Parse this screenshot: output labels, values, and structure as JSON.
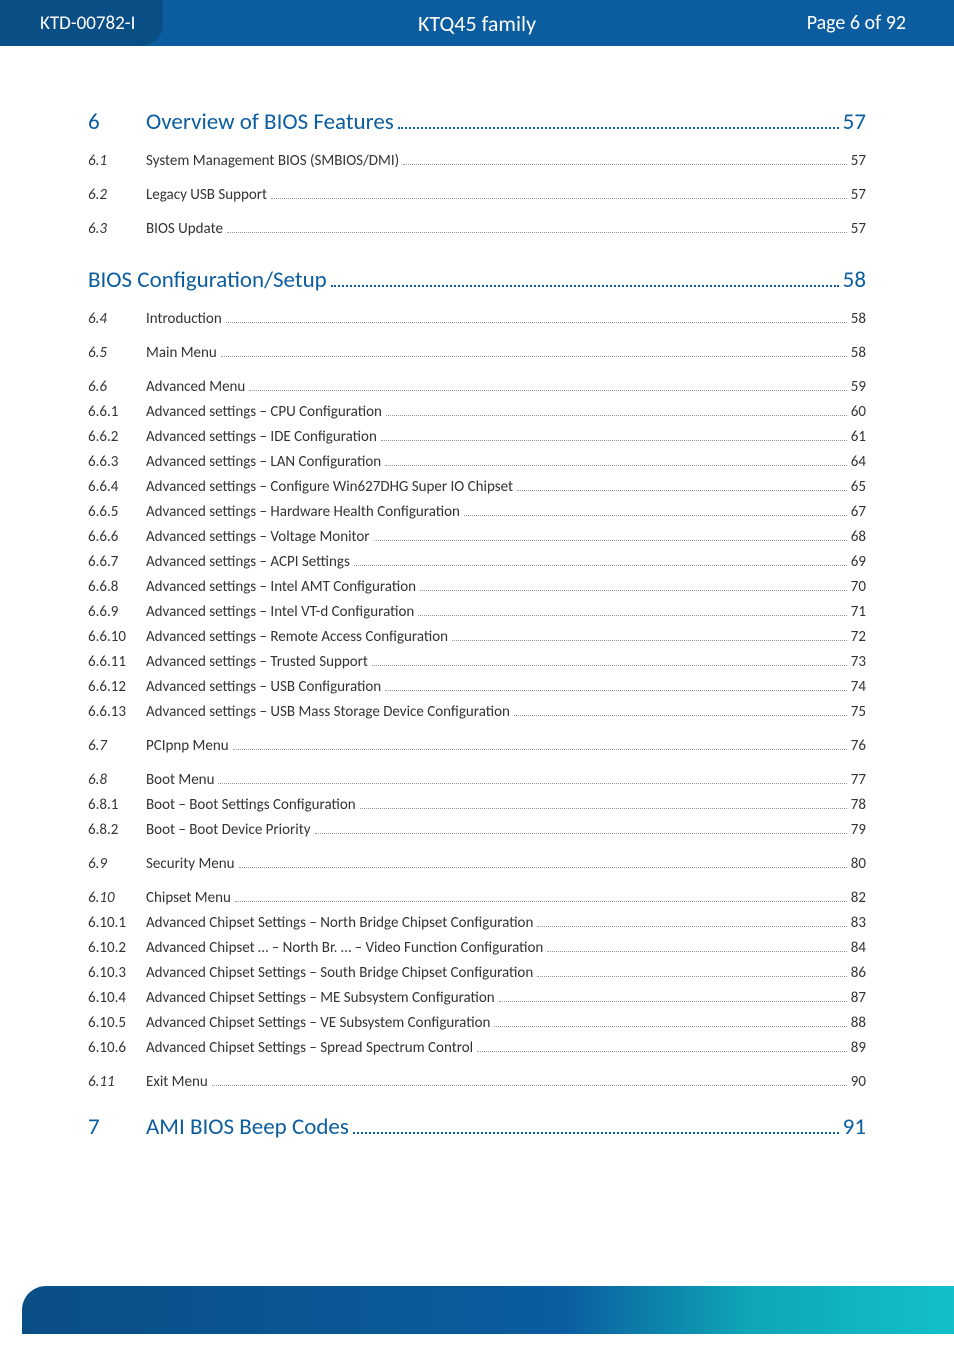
{
  "header": {
    "doc_id": "KTD-00782-I",
    "family": "KTQ45 family",
    "page_label": "Page 6 of 92"
  },
  "toc": [
    {
      "level": "chapter",
      "num": "6",
      "title": "Overview of BIOS Features",
      "page": "57"
    },
    {
      "level": "h2",
      "num": "6.1",
      "title": "System Management BIOS (SMBIOS/DMI)",
      "page": "57"
    },
    {
      "level": "h2",
      "num": "6.2",
      "title": "Legacy USB Support",
      "page": "57"
    },
    {
      "level": "h2",
      "num": "6.3",
      "title": "BIOS Update",
      "page": "57"
    },
    {
      "level": "section-heading",
      "num": "",
      "title": "BIOS Configuration/Setup",
      "page": "58"
    },
    {
      "level": "h2",
      "num": "6.4",
      "title": "Introduction",
      "page": "58"
    },
    {
      "level": "h2",
      "num": "6.5",
      "title": "Main Menu",
      "page": "58"
    },
    {
      "level": "h2",
      "num": "6.6",
      "title": "Advanced Menu",
      "page": "59"
    },
    {
      "level": "h3",
      "num": "6.6.1",
      "title": "Advanced settings – CPU Configuration",
      "page": "60"
    },
    {
      "level": "h3",
      "num": "6.6.2",
      "title": "Advanced settings – IDE Configuration",
      "page": "61"
    },
    {
      "level": "h3",
      "num": "6.6.3",
      "title": "Advanced settings – LAN Configuration",
      "page": "64"
    },
    {
      "level": "h3",
      "num": "6.6.4",
      "title": "Advanced settings – Configure Win627DHG Super IO Chipset",
      "page": "65"
    },
    {
      "level": "h3",
      "num": "6.6.5",
      "title": "Advanced settings – Hardware Health Configuration",
      "page": "67"
    },
    {
      "level": "h3",
      "num": "6.6.6",
      "title": "Advanced settings – Voltage Monitor",
      "page": "68"
    },
    {
      "level": "h3",
      "num": "6.6.7",
      "title": "Advanced settings – ACPI Settings",
      "page": "69"
    },
    {
      "level": "h3",
      "num": "6.6.8",
      "title": "Advanced settings – Intel AMT Configuration",
      "page": "70"
    },
    {
      "level": "h3",
      "num": "6.6.9",
      "title": "Advanced settings – Intel VT-d Configuration",
      "page": "71"
    },
    {
      "level": "h3",
      "num": "6.6.10",
      "title": "Advanced settings – Remote Access Configuration",
      "page": "72"
    },
    {
      "level": "h3",
      "num": "6.6.11",
      "title": "Advanced settings – Trusted Support",
      "page": "73"
    },
    {
      "level": "h3",
      "num": "6.6.12",
      "title": "Advanced settings – USB Configuration",
      "page": "74"
    },
    {
      "level": "h3",
      "num": "6.6.13",
      "title": "Advanced settings – USB Mass Storage Device Configuration",
      "page": "75"
    },
    {
      "level": "h2",
      "num": "6.7",
      "title": "PCIpnp Menu",
      "page": "76"
    },
    {
      "level": "h2",
      "num": "6.8",
      "title": "Boot Menu",
      "page": "77"
    },
    {
      "level": "h3",
      "num": "6.8.1",
      "title": "Boot – Boot Settings Configuration",
      "page": "78"
    },
    {
      "level": "h3",
      "num": "6.8.2",
      "title": "Boot – Boot Device Priority",
      "page": "79"
    },
    {
      "level": "h2",
      "num": "6.9",
      "title": "Security Menu",
      "page": "80"
    },
    {
      "level": "h2",
      "num": "6.10",
      "title": "Chipset Menu",
      "page": "82"
    },
    {
      "level": "h3",
      "num": "6.10.1",
      "title": "Advanced Chipset Settings – North Bridge Chipset Configuration",
      "page": "83"
    },
    {
      "level": "h3",
      "num": "6.10.2",
      "title": "Advanced Chipset … – North Br. … – Video Function Configuration",
      "page": "84"
    },
    {
      "level": "h3",
      "num": "6.10.3",
      "title": "Advanced Chipset Settings – South Bridge Chipset Configuration",
      "page": "86"
    },
    {
      "level": "h3",
      "num": "6.10.4",
      "title": "Advanced Chipset Settings – ME Subsystem Configuration",
      "page": "87"
    },
    {
      "level": "h3",
      "num": "6.10.5",
      "title": "Advanced Chipset Settings – VE Subsystem Configuration",
      "page": "88"
    },
    {
      "level": "h3",
      "num": "6.10.6",
      "title": "Advanced Chipset Settings – Spread Spectrum Control",
      "page": "89"
    },
    {
      "level": "h2",
      "num": "6.11",
      "title": "Exit Menu",
      "page": "90"
    },
    {
      "level": "chapter",
      "num": "7",
      "title": "AMI BIOS Beep Codes",
      "page": "91"
    }
  ]
}
